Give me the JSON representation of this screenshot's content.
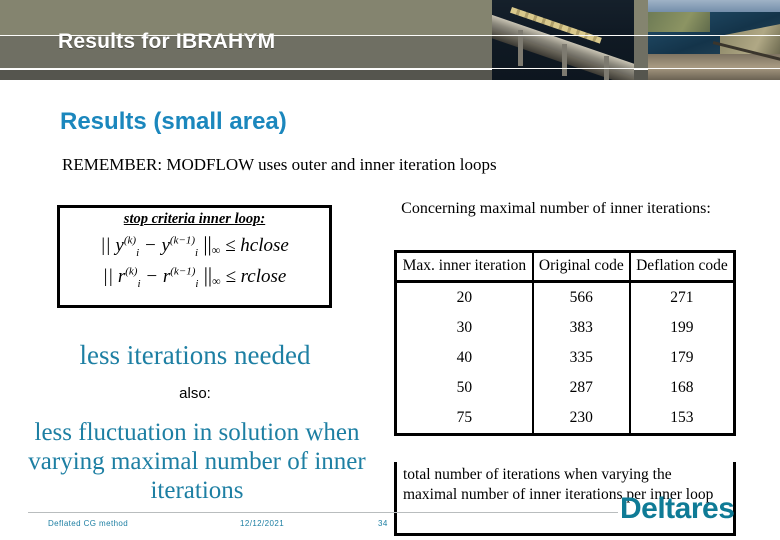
{
  "banner": {
    "title": "Results for IBRAHYM",
    "photo_bridge_alt": "bridge-photo",
    "photo_aerial_alt": "aerial-river-photo"
  },
  "slide": {
    "heading": "Results (small area)",
    "remember_line": "REMEMBER:  MODFLOW uses outer and inner iteration loops"
  },
  "equation_box": {
    "caption": "stop criteria inner loop:",
    "line1": {
      "prefix": "|| y",
      "sup1": "(k)",
      "sub1": "i",
      "minus": " − y",
      "sup2": "(k−1)",
      "sub2": "i",
      "norm": " ||",
      "inf": "∞",
      "rel": " ≤ hclose"
    },
    "line2": {
      "prefix": "|| r",
      "sup1": "(k)",
      "sub1": "i",
      "minus": " − r",
      "sup2": "(k−1)",
      "sub2": "i",
      "norm": " ||",
      "inf": "∞",
      "rel": " ≤ rclose"
    }
  },
  "statements": {
    "less_iterations": "less iterations needed",
    "also_label": "also:",
    "less_fluctuation": "less fluctuation in solution when varying maximal number of inner iterations"
  },
  "table_intro": "Concerning maximal number of inner iterations:",
  "table": {
    "headers": [
      "Max. inner iteration",
      "Original code",
      "Deflation code"
    ],
    "rows": [
      [
        "20",
        "566",
        "271"
      ],
      [
        "30",
        "383",
        "199"
      ],
      [
        "40",
        "335",
        "179"
      ],
      [
        "50",
        "287",
        "168"
      ],
      [
        "75",
        "230",
        "153"
      ]
    ],
    "caption": "total number of iterations when varying the maximal number of inner iterations per inner loop"
  },
  "logo": {
    "text": "Deltares"
  },
  "footer": {
    "subject": "Deflated CG method",
    "date": "12/12/2021",
    "page": "34"
  },
  "colors": {
    "accent_blue": "#1b87bd",
    "teal": "#1d7fa3",
    "logo_teal": "#0f7b96",
    "banner_top": "#84846f",
    "banner_mid": "#6f6f63",
    "banner_bottom": "#55554e"
  }
}
